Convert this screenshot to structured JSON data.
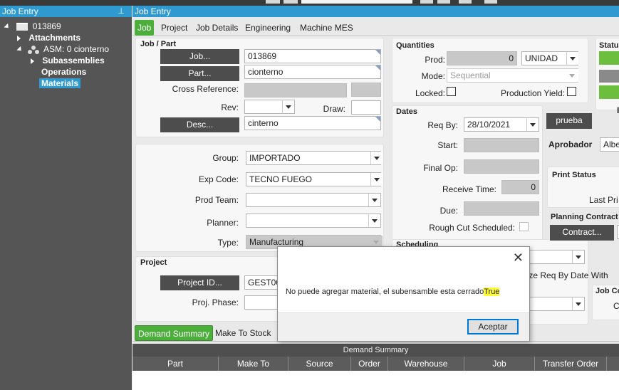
{
  "tree": {
    "title": "Job Entry",
    "pin_icon": "pin-icon",
    "items": [
      {
        "label": "013869"
      },
      {
        "label": "Attachments"
      },
      {
        "label": "ASM: 0 cionterno"
      },
      {
        "label": "Subassemblies"
      },
      {
        "label": "Operations"
      },
      {
        "label": "Materials"
      }
    ]
  },
  "main": {
    "title": "Job Entry",
    "tabs": [
      "Job",
      "Project",
      "Job Details",
      "Engineering",
      "Machine MES"
    ]
  },
  "job_part": {
    "title": "Job / Part",
    "job_button": "Job...",
    "job_value": "013869",
    "part_button": "Part...",
    "part_value": "cionterno",
    "cross_reference_label": "Cross Reference:",
    "rev_label": "Rev:",
    "draw_label": "Draw:",
    "desc_button": "Desc...",
    "desc_value": "cinterno"
  },
  "classification": {
    "group_label": "Group:",
    "group_value": "IMPORTADO",
    "exp_code_label": "Exp Code:",
    "exp_code_value": "TECNO FUEGO",
    "prod_team_label": "Prod Team:",
    "planner_label": "Planner:",
    "type_label": "Type:",
    "type_value": "Manufacturing"
  },
  "project": {
    "title": "Project",
    "project_id_button": "Project ID...",
    "project_id_value": "GEST00",
    "proj_phase_label": "Proj. Phase:"
  },
  "quantities": {
    "title": "Quantities",
    "prod_label": "Prod:",
    "prod_value": "0",
    "uom_value": "UNIDAD",
    "mode_label": "Mode:",
    "mode_value": "Sequential",
    "locked_label": "Locked:",
    "production_yield_label": "Production Yield:"
  },
  "dates": {
    "title": "Dates",
    "req_by_label": "Req By:",
    "req_by_value": "28/10/2021",
    "start_label": "Start:",
    "final_op_label": "Final Op:",
    "receive_time_label": "Receive Time:",
    "receive_time_value": "0",
    "due_label": "Due:",
    "rough_cut_label": "Rough Cut Scheduled:"
  },
  "scheduling": {
    "title": "Scheduling",
    "minimize_text": "nize Req By Date With"
  },
  "right_col": {
    "status_title": "Status",
    "prueba_button": "prueba",
    "aprobador_label": "Aprobador",
    "aprobador_value": "Albe",
    "print_status_title": "Print Status",
    "last_print_label": "Last Pri",
    "planning_title": "Planning Contract",
    "contract_button": "Contract...",
    "job_co_title": "Job Co",
    "job_co_label": "C"
  },
  "bottom": {
    "tabs": [
      "Demand Summary",
      "Make To Stock"
    ],
    "grid_title": "Demand Summary",
    "columns": [
      "Part",
      "Make To",
      "Source",
      "Order",
      "Warehouse",
      "Job",
      "Transfer Order"
    ]
  },
  "modal": {
    "message": "No puede agregar material, el subensamble esta cerrado",
    "highlight": "True",
    "ok_label": "Aceptar",
    "close_icon": "close-icon"
  },
  "colors": {
    "accent": "#2e9ad0",
    "tab_active": "#4caf3b",
    "button_dark": "#4d4d4d",
    "highlight": "#ffff33"
  }
}
